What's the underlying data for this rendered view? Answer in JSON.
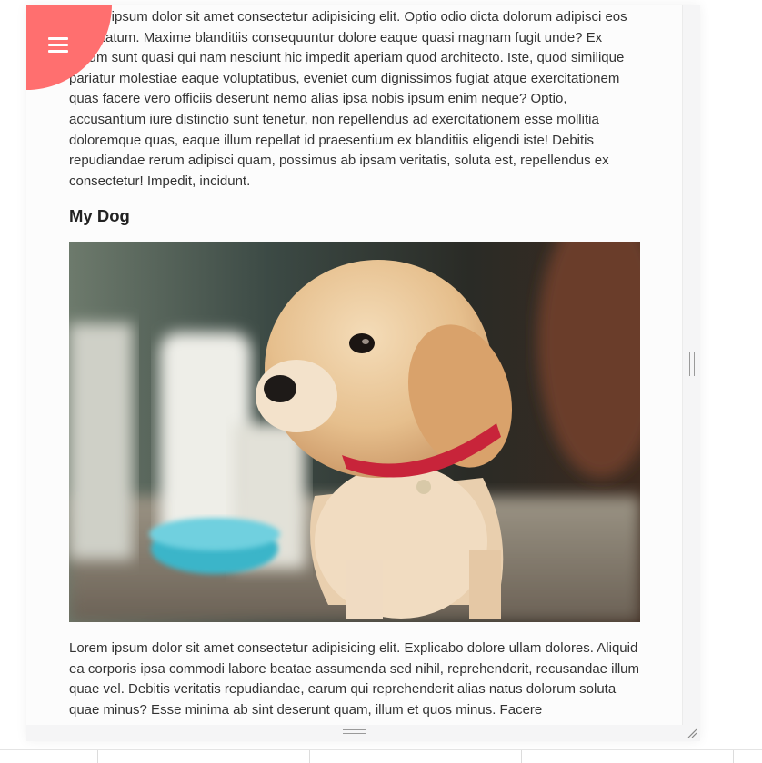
{
  "menu": {
    "icon": "hamburger-menu-icon"
  },
  "article": {
    "paragraph_top": "Lorem ipsum dolor sit amet consectetur adipisicing elit. Optio odio dicta dolorum adipisci eos voluptatum. Maxime blanditiis consequuntur dolore eaque quasi magnam fugit unde? Ex harum sunt quasi qui nam nesciunt hic impedit aperiam quod architecto. Iste, quod similique pariatur molestiae eaque voluptatibus, eveniet cum dignissimos fugiat atque exercitationem quas facere vero officiis deserunt nemo alias ipsa nobis ipsum enim neque? Optio, accusantium iure distinctio sunt tenetur, non repellendus ad exercitationem esse mollitia doloremque quas, eaque illum repellat id praesentium ex blanditiis eligendi iste! Debitis repudiandae rerum adipisci quam, possimus ab ipsam veritatis, soluta est, repellendus ex consectetur! Impedit, incidunt.",
    "heading": "My Dog",
    "image": "puppy-photo",
    "paragraph_bottom": "Lorem ipsum dolor sit amet consectetur adipisicing elit. Explicabo dolore ullam dolores. Aliquid ea corporis ipsa commodi labore beatae assumenda sed nihil, reprehenderit, recusandae illum quae vel. Debitis veritatis repudiandae, earum qui reprehenderit alias natus dolorum soluta quae minus? Esse minima ab sint deserunt quam, illum et quos minus. Facere"
  },
  "colors": {
    "accent": "#ff6f6f",
    "text": "#333333",
    "heading": "#222222"
  }
}
